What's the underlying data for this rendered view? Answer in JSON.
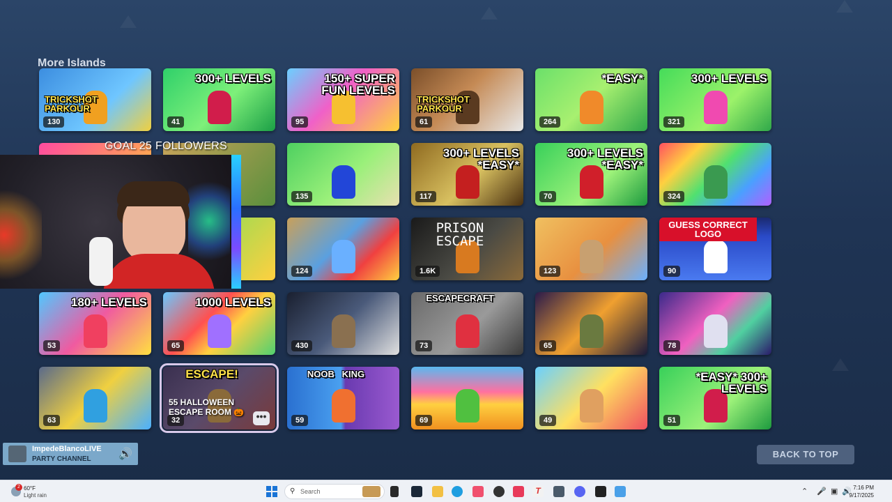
{
  "section": {
    "title": "More Islands"
  },
  "tiles": [
    {
      "count": "130",
      "text": "TRICKSHOT PARKOUR",
      "bg": "linear-gradient(135deg,#3c8ee0,#6fc6ff 60%,#f0d040)",
      "fig": "#f0a020"
    },
    {
      "count": "41",
      "text": "300+ LEVELS",
      "bg": "linear-gradient(135deg,#2fd06a,#7ef07a 55%,#1b9f46)",
      "fig": "#d11d4b"
    },
    {
      "count": "95",
      "text": "150+ SUPER FUN LEVELS",
      "bg": "linear-gradient(135deg,#6ad0ff,#f060c8 45%,#ffd23c)",
      "fig": "#f6c030"
    },
    {
      "count": "61",
      "text": "TRICKSHOT PARKOUR",
      "bg": "linear-gradient(135deg,#7b4f2a,#c58a55 45%,#e8e8e8)",
      "fig": "#5a3a20"
    },
    {
      "count": "264",
      "text": "*EASY*",
      "bg": "linear-gradient(135deg,#6be06a,#a8f070 50%,#2fa84a)",
      "fig": "#f08a2a"
    },
    {
      "count": "321",
      "text": "300+ LEVELS",
      "bg": "linear-gradient(135deg,#45dc5a,#9cf26a 60%,#2fa84a)",
      "fig": "#f04ab0"
    },
    {
      "count": "",
      "text": "",
      "bg": "linear-gradient(135deg,#ff4aa0,#ffcc33)",
      "fig": "#d22"
    },
    {
      "count": "",
      "text": "",
      "bg": "linear-gradient(135deg,#c7a35a,#5a8f3c)",
      "fig": "#f0b020"
    },
    {
      "count": "135",
      "text": "",
      "bg": "linear-gradient(135deg,#4ed060,#9af07a 55%,#e8e0b0)",
      "fig": "#2246d8"
    },
    {
      "count": "117",
      "text": "300+ LEVELS *EASY*",
      "bg": "linear-gradient(135deg,#8f6a20,#d8c060 55%,#4a3010)",
      "fig": "#c41f1f"
    },
    {
      "count": "70",
      "text": "300+ LEVELS *EASY*",
      "bg": "linear-gradient(135deg,#38d05a,#9df27a 60%,#1c9a3e)",
      "fig": "#d01f2a"
    },
    {
      "count": "324",
      "text": "",
      "bg": "linear-gradient(135deg,#ff5060,#ffd040 25%,#50e070 50%,#4aa0ff 75%,#b060ff)",
      "fig": "#3a9a50"
    },
    {
      "count": "",
      "text": "",
      "bg": "linear-gradient(135deg,#6ee05a,#c03030)",
      "fig": "#30a040"
    },
    {
      "count": "",
      "text": "",
      "bg": "linear-gradient(135deg,#6ee05a,#ffd040)",
      "fig": "#e03030"
    },
    {
      "count": "124",
      "text": "",
      "bg": "linear-gradient(135deg,#c9a05a,#5aa0e0 45%,#f04040 70%,#ffd040)",
      "fig": "#6ab0ff"
    },
    {
      "count": "1.6K",
      "text": "PRISON ESCAPE",
      "bg": "linear-gradient(135deg,#1a1a1a,#4a4a44 55%,#8a6a3a)",
      "fig": "#d87a20"
    },
    {
      "count": "123",
      "text": "",
      "bg": "linear-gradient(135deg,#f0c060,#e89040 55%,#6ab0ff)",
      "fig": "#c8a070"
    },
    {
      "count": "90",
      "text": "GUESS CORRECT LOGO",
      "bg": "linear-gradient(180deg,#1a2a70 0%,#2a4ac8 30%,#4a7af0 100%)",
      "fig": "#ffffff"
    },
    {
      "count": "53",
      "text": "180+ LEVELS",
      "bg": "linear-gradient(135deg,#50c8ff,#f05aa0 50%,#ffe040)",
      "fig": "#f04060"
    },
    {
      "count": "65",
      "text": "1000 LEVELS",
      "bg": "linear-gradient(135deg,#6ac8ff,#ff5050 40%,#ffd040 60%,#50d070)",
      "fig": "#a070ff"
    },
    {
      "count": "430",
      "text": "",
      "bg": "linear-gradient(135deg,#1a2030,#4a5a7a 50%,#e0e0e0)",
      "fig": "#8a7050"
    },
    {
      "count": "73",
      "text": "ESCAPECRAFT",
      "bg": "linear-gradient(135deg,#6a6a6a,#9a9a9a 55%,#3a3a3a)",
      "fig": "#e03040"
    },
    {
      "count": "65",
      "text": "",
      "bg": "linear-gradient(135deg,#2a1a4a,#f0a030 50%,#1a1a3a)",
      "fig": "#6a7a40"
    },
    {
      "count": "78",
      "text": "",
      "bg": "linear-gradient(135deg,#3a2a8a,#f060c0 45%,#50d0a0 70%,#2a1a6a)",
      "fig": "#e0e0f0"
    },
    {
      "count": "63",
      "text": "",
      "bg": "linear-gradient(135deg,#5a6a8a,#f0d040 50%,#4ab0ff)",
      "fig": "#30a0e0"
    },
    {
      "count": "32",
      "text": "ESCAPE!",
      "bg": "linear-gradient(135deg,#3a3050,#5a4a6a 50%,#7a3a3a)",
      "fig": "#8a6a3a",
      "selected": true,
      "hover": "55 HALLOWEEN ESCAPE ROOM 🎃"
    },
    {
      "count": "59",
      "text": "NOOB   KING",
      "bg": "linear-gradient(90deg,#2a70d0 0%,#4aa0f0 48%,#6a3ab0 52%,#9a5ad0 100%)",
      "fig": "#f07030"
    },
    {
      "count": "69",
      "text": "",
      "bg": "linear-gradient(180deg,#5ab8f0 0%,#ff70a0 40%,#ffd040 60%,#f09020 100%)",
      "fig": "#50c040"
    },
    {
      "count": "49",
      "text": "",
      "bg": "linear-gradient(135deg,#6ad0ff,#ffe060 50%,#f05060)",
      "fig": "#e0a060"
    },
    {
      "count": "51",
      "text": "*EASY* 300+ LEVELS",
      "bg": "linear-gradient(135deg,#38d05a,#9df27a 60%,#1c9a3e)",
      "fig": "#d11d4b"
    }
  ],
  "overlay": {
    "goal": "GOAL 25 FOLLOWERS"
  },
  "party": {
    "name": "ImpedeBlancoLIVE",
    "channel": "PARTY CHANNEL"
  },
  "back_to_top": "BACK TO TOP",
  "taskbar": {
    "weather_temp": "60°F",
    "weather_cond": "Light rain",
    "weather_badge": "2",
    "search_placeholder": "Search",
    "time": "7:16 PM",
    "date": "9/17/2025"
  }
}
